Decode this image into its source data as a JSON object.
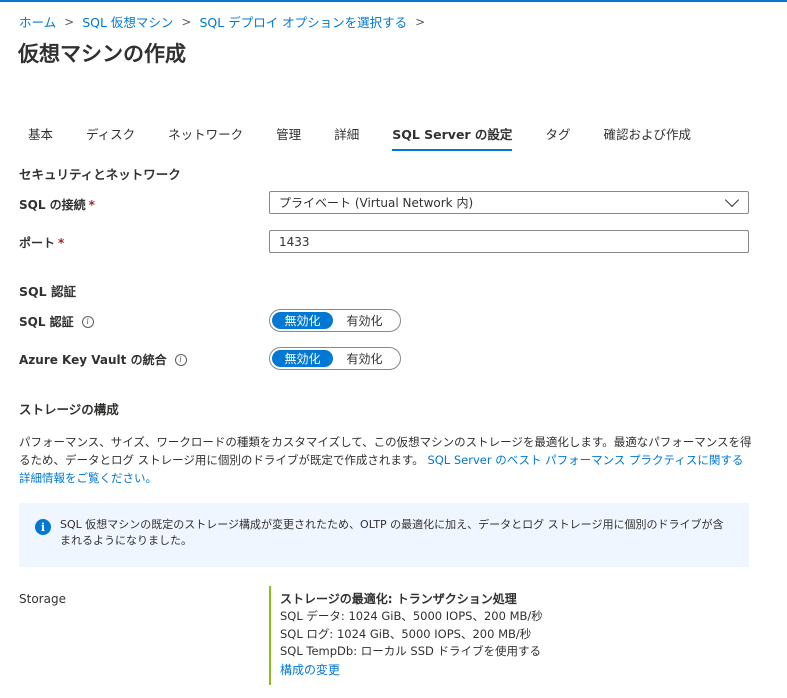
{
  "breadcrumb": [
    {
      "label": "ホーム"
    },
    {
      "label": "SQL 仮想マシン"
    },
    {
      "label": "SQL デプロイ オプションを選択する"
    }
  ],
  "breadcrumb_separator": ">",
  "page_title": "仮想マシンの作成",
  "tabs": [
    {
      "label": "基本"
    },
    {
      "label": "ディスク"
    },
    {
      "label": "ネットワーク"
    },
    {
      "label": "管理"
    },
    {
      "label": "詳細"
    },
    {
      "label": "SQL Server の設定",
      "active": true
    },
    {
      "label": "タグ"
    },
    {
      "label": "確認および作成"
    }
  ],
  "security_network": {
    "heading": "セキュリティとネットワーク",
    "sql_connectivity": {
      "label": "SQL の接続",
      "required_mark": "*",
      "selected_value": "プライベート (Virtual Network 内)"
    },
    "port": {
      "label": "ポート",
      "required_mark": "*",
      "value": "1433"
    }
  },
  "sql_auth_section": {
    "heading": "SQL 認証",
    "sql_auth": {
      "label": "SQL 認証",
      "info_icon": "info-icon",
      "options": [
        "無効化",
        "有効化"
      ],
      "selected": "無効化"
    },
    "akv": {
      "label": "Azure Key Vault の統合",
      "info_icon": "info-icon",
      "options": [
        "無効化",
        "有効化"
      ],
      "selected": "無効化"
    }
  },
  "storage_config": {
    "heading": "ストレージの構成",
    "description": "パフォーマンス、サイズ、ワークロードの種類をカスタマイズして、この仮想マシンのストレージを最適化します。最適なパフォーマンスを得るため、データとログ ストレージ用に個別のドライブが既定で作成されます。",
    "link": "SQL Server のベスト パフォーマンス プラクティスに関する詳細情報をご覧ください。",
    "info_message": "SQL 仮想マシンの既定のストレージ構成が変更されたため、OLTP の最適化に加え、データとログ ストレージ用に個別のドライブが含まれるようになりました。",
    "info_icon_glyph": "i"
  },
  "storage": {
    "label": "Storage",
    "title": "ストレージの最適化: トランザクション処理",
    "data_line": "SQL データ: 1024 GiB、5000 IOPS、200 MB/秒",
    "log_line": "SQL ログ: 1024 GiB、5000 IOPS、200 MB/秒",
    "tempdb_line": "SQL TempDb: ローカル SSD ドライブを使用する",
    "change_link": "構成の変更"
  },
  "colors": {
    "accent": "#0078d4",
    "required": "#a4262c",
    "storage_bar": "#8cbd18",
    "info_background": "#f0f6ff"
  }
}
